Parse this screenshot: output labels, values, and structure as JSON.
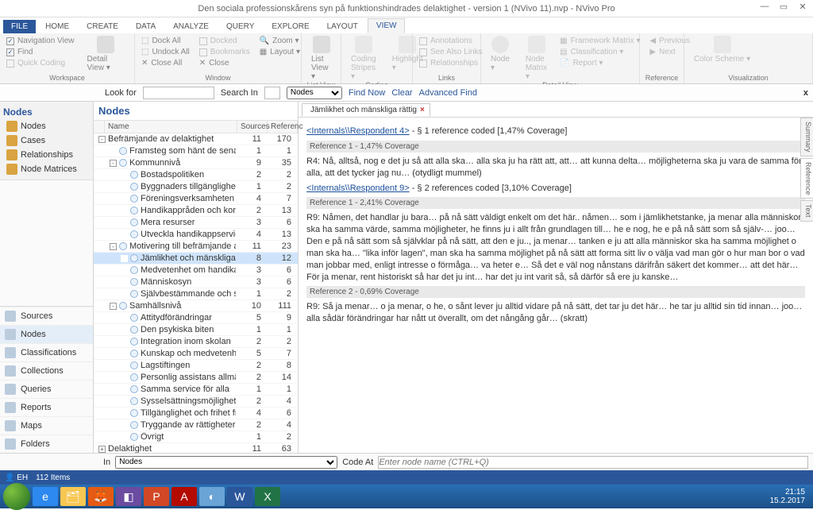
{
  "title": "Den sociala professionskårens syn på funktionshindrades delaktighet - version 1 (NVivo 11).nvp - NVivo Pro",
  "ribbon_tabs": [
    "FILE",
    "HOME",
    "CREATE",
    "DATA",
    "ANALYZE",
    "QUERY",
    "EXPLORE",
    "LAYOUT",
    "VIEW"
  ],
  "active_tab_index": 8,
  "workspace": {
    "group": "Workspace",
    "nav_view": "Navigation View",
    "find": "Find",
    "quick_coding": "Quick Coding",
    "detail_view": "Detail View ▾"
  },
  "window": {
    "group": "Window",
    "dock_all": "Dock All",
    "undock_all": "Undock All",
    "close_all": "Close All",
    "docked": "Docked",
    "bookmarks": "Bookmarks",
    "close": "Close",
    "zoom": "Zoom ▾",
    "layout": "Layout ▾"
  },
  "listview": {
    "group": "List View",
    "label": "List View ▾"
  },
  "coding_grp": {
    "group": "Coding",
    "stripes": "Coding Stripes ▾",
    "highlight": "Highlight ▾"
  },
  "links_grp": {
    "group": "Links",
    "annotations": "Annotations",
    "seealso": "See Also Links",
    "relationships": "Relationships"
  },
  "detailview_grp": {
    "group": "Detail View",
    "node": "Node ▾",
    "nodematrix": "Node Matrix ▾",
    "fm": "Framework Matrix ▾",
    "class": "Classification ▾",
    "report": "Report ▾",
    "prev": "Previous",
    "next": "Next"
  },
  "reference_grp": {
    "group": "Reference"
  },
  "viz_grp": {
    "group": "Visualization",
    "color": "Color Scheme ▾"
  },
  "search": {
    "lookfor": "Look for",
    "searchin": "Search In",
    "list_label": "Nodes",
    "findnow": "Find Now",
    "clear": "Clear",
    "advanced": "Advanced Find"
  },
  "nav": {
    "hdr": "Nodes",
    "top": [
      "Nodes",
      "Cases",
      "Relationships",
      "Node Matrices"
    ],
    "bottom": [
      "Sources",
      "Nodes",
      "Classifications",
      "Collections",
      "Queries",
      "Reports",
      "Maps",
      "Folders"
    ],
    "active_bottom": 1
  },
  "nodes": {
    "hdr": "Nodes",
    "cols": {
      "name": "Name",
      "sources": "Sources",
      "refs": "Referenc"
    },
    "rows": [
      {
        "d": 0,
        "t": "-",
        "n": "Befrämjande av delaktighet",
        "s": 11,
        "r": 170
      },
      {
        "d": 1,
        "t": "",
        "dot": 1,
        "n": "Framsteg som hänt de senaste åren",
        "s": 1,
        "r": 1
      },
      {
        "d": 1,
        "t": "-",
        "dot": 1,
        "n": "Kommunnivå",
        "s": 9,
        "r": 35
      },
      {
        "d": 2,
        "t": "",
        "dot": 1,
        "n": "Bostadspolitiken",
        "s": 2,
        "r": 2
      },
      {
        "d": 2,
        "t": "",
        "dot": 1,
        "n": "Byggnaders tillgänglighet",
        "s": 1,
        "r": 2
      },
      {
        "d": 2,
        "t": "",
        "dot": 1,
        "n": "Föreningsverksamheten",
        "s": 4,
        "r": 7
      },
      {
        "d": 2,
        "t": "",
        "dot": 1,
        "n": "Handikappråden och kommunpoliti",
        "s": 2,
        "r": 13
      },
      {
        "d": 2,
        "t": "",
        "dot": 1,
        "n": "Mera resurser",
        "s": 3,
        "r": 6
      },
      {
        "d": 2,
        "t": "",
        "dot": 1,
        "n": "Utveckla handikappservicen i kom",
        "s": 4,
        "r": 13
      },
      {
        "d": 1,
        "t": "-",
        "dot": 1,
        "n": "Motivering till befrämjande av delaktig",
        "s": 11,
        "r": 23
      },
      {
        "d": 2,
        "t": "",
        "dot": 1,
        "n": "Jämlikhet och mänskliga rättigheter",
        "s": 8,
        "r": 12,
        "sel": 1
      },
      {
        "d": 2,
        "t": "",
        "dot": 1,
        "n": "Medvetenhet om handikappfrågor",
        "s": 3,
        "r": 6
      },
      {
        "d": 2,
        "t": "",
        "dot": 1,
        "n": "Människosyn",
        "s": 3,
        "r": 6
      },
      {
        "d": 2,
        "t": "",
        "dot": 1,
        "n": "Självbestämmande och synlighet fö",
        "s": 1,
        "r": 2
      },
      {
        "d": 1,
        "t": "-",
        "dot": 1,
        "n": "Samhällsnivå",
        "s": 10,
        "r": 111
      },
      {
        "d": 2,
        "t": "",
        "dot": 1,
        "n": "Attitydförändringar",
        "s": 5,
        "r": 9
      },
      {
        "d": 2,
        "t": "",
        "dot": 1,
        "n": "Den psykiska biten",
        "s": 1,
        "r": 1
      },
      {
        "d": 2,
        "t": "",
        "dot": 1,
        "n": "Integration inom skolan",
        "s": 2,
        "r": 2
      },
      {
        "d": 2,
        "t": "",
        "dot": 1,
        "n": "Kunskap och medvetenhet om han",
        "s": 5,
        "r": 7
      },
      {
        "d": 2,
        "t": "",
        "dot": 1,
        "n": "Lagstiftingen",
        "s": 2,
        "r": 8
      },
      {
        "d": 2,
        "t": "",
        "dot": 1,
        "n": "Personlig assistans allmänt",
        "s": 2,
        "r": 14
      },
      {
        "d": 2,
        "t": "",
        "dot": 1,
        "n": "Samma service för alla",
        "s": 1,
        "r": 1
      },
      {
        "d": 2,
        "t": "",
        "dot": 1,
        "n": "Sysselsättningsmöjligheter",
        "s": 2,
        "r": 4
      },
      {
        "d": 2,
        "t": "",
        "dot": 1,
        "n": "Tillgänglighet och frihet från hinder",
        "s": 4,
        "r": 6
      },
      {
        "d": 2,
        "t": "",
        "dot": 1,
        "n": "Tryggande av rättigheterna",
        "s": 2,
        "r": 4
      },
      {
        "d": 2,
        "t": "",
        "dot": 1,
        "n": "Övrigt",
        "s": 1,
        "r": 2
      },
      {
        "d": 0,
        "t": "+",
        "n": "Delaktighet",
        "s": 11,
        "r": 63
      },
      {
        "d": 0,
        "t": "+",
        "n": "Funktionshindrade som grupp",
        "s": 11,
        "r": 119
      },
      {
        "d": 0,
        "t": "+",
        "n": "Handikappservice i praktiken",
        "s": 11,
        "r": 636
      },
      {
        "d": 0,
        "t": "+",
        "n": "Problem eller hinder för delaktighet",
        "s": 11,
        "r": 197
      }
    ]
  },
  "detail": {
    "tab": "Jämlikhet och mänskliga rättig",
    "line1a": "<Internals\\\\Respondent 4>",
    "line1b": " - § 1 reference coded  [1,47% Coverage]",
    "ref1": "Reference 1 - 1,47% Coverage",
    "p1": "R4: Nå, alltså, nog e det ju så att alla ska… alla ska ju ha rätt att, att… att kunna delta… möjligheterna ska ju vara de samma för alla, att det tycker jag nu… (otydligt mummel)",
    "line2a": "<Internals\\\\Respondent 9>",
    "line2b": " - § 2 references coded  [3,10% Coverage]",
    "ref2": "Reference 1 - 2,41% Coverage",
    "p2": "R9: Nåmen, det handlar ju bara… på nå sätt väldigt enkelt om det här.. nåmen… som i jämlikhetstanke, ja menar alla människor ska ha samma värde, samma möjligheter, he finns ju i allt från grundlagen till… he e nog, he e på nå sätt som så själv-… joo… Den e på nå sätt som så självklar på nå sätt, att den e ju.., ja menar… tanken e ju att alla människor ska ha samma möjlighet o man ska ha… \"lika inför lagen\", man ska ha samma möjlighet på nå sätt att forma sitt liv o välja vad man gör o hur man bor o vad man jobbar med, enligt intresse o förmåga… va heter e… Så det e väl nog nånstans därifrån säkert det kommer… att det här… För ja menar, rent historiskt så har det ju int… har det ju int varit så, så därför så ere ju kanske…",
    "ref3": "Reference 2 - 0,69% Coverage",
    "p3": "R9: Så ja menar… o ja menar, o he, o sånt lever ju alltid vidare på nå sätt, det tar ju det här… he tar ju alltid sin tid innan… joo… alla sådär förändringar har nått ut överallt, om det nångång går… (skratt)",
    "side": [
      "Summary",
      "Reference",
      "Text"
    ]
  },
  "footer": {
    "in": "In",
    "nodes": "Nodes",
    "codeat": "Code At",
    "placeholder": "Enter node name (CTRL+Q)"
  },
  "status": {
    "user": "EH",
    "items": "112 Items"
  },
  "clock": {
    "time": "21:15",
    "date": "15.2.2017"
  }
}
